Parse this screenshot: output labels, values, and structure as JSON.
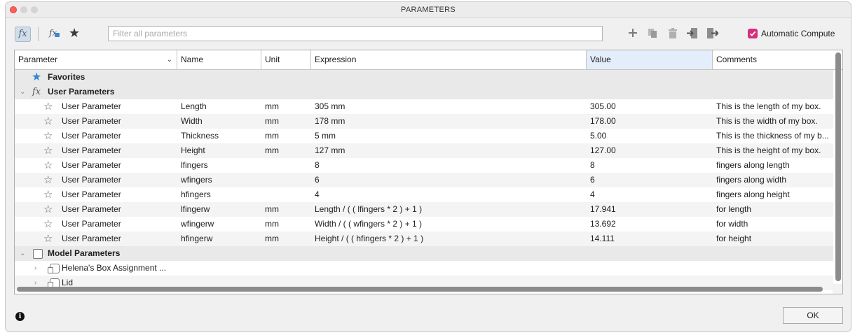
{
  "window": {
    "title": "PARAMETERS"
  },
  "toolbar": {
    "fx_label": "fx",
    "fx2_label": "fx",
    "favorites_icon": "star-icon",
    "search_placeholder": "Filter all parameters",
    "auto_compute_label": "Automatic Compute",
    "auto_compute_checked": true,
    "accent_color": "#d62e7c"
  },
  "columns": [
    "Parameter",
    "Name",
    "Unit",
    "Expression",
    "Value",
    "Comments"
  ],
  "groups": {
    "favorites": "Favorites",
    "user": "User Parameters",
    "model": "Model Parameters"
  },
  "user_params": [
    {
      "param": "User Parameter",
      "name": "Length",
      "unit": "mm",
      "expression": "305 mm",
      "value": "305.00",
      "comment": "This is the length of my box."
    },
    {
      "param": "User Parameter",
      "name": "Width",
      "unit": "mm",
      "expression": "178 mm",
      "value": "178.00",
      "comment": "This is the width of my box."
    },
    {
      "param": "User Parameter",
      "name": "Thickness",
      "unit": "mm",
      "expression": "5 mm",
      "value": "5.00",
      "comment": "This is the thickness of my b..."
    },
    {
      "param": "User Parameter",
      "name": "Height",
      "unit": "mm",
      "expression": "127 mm",
      "value": "127.00",
      "comment": "This is the height of my box."
    },
    {
      "param": "User Parameter",
      "name": "lfingers",
      "unit": "",
      "expression": "8",
      "value": "8",
      "comment": "fingers along length"
    },
    {
      "param": "User Parameter",
      "name": "wfingers",
      "unit": "",
      "expression": "6",
      "value": "6",
      "comment": "fingers along width"
    },
    {
      "param": "User Parameter",
      "name": "hfingers",
      "unit": "",
      "expression": "4",
      "value": "4",
      "comment": "fingers along height"
    },
    {
      "param": "User Parameter",
      "name": "lfingerw",
      "unit": "mm",
      "expression": "Length / ( ( lfingers * 2 ) + 1 )",
      "value": "17.941",
      "comment": "for length"
    },
    {
      "param": "User Parameter",
      "name": "wfingerw",
      "unit": "mm",
      "expression": "Width / ( ( wfingers * 2 ) + 1 )",
      "value": "13.692",
      "comment": "for width"
    },
    {
      "param": "User Parameter",
      "name": "hfingerw",
      "unit": "mm",
      "expression": "Height / ( ( hfingers * 2 ) + 1 )",
      "value": "14.111",
      "comment": "for height"
    }
  ],
  "model_items": [
    {
      "label": "Helena's Box Assignment ..."
    },
    {
      "label": "Lid"
    }
  ],
  "footer": {
    "ok_label": "OK",
    "info_glyph": "i"
  }
}
